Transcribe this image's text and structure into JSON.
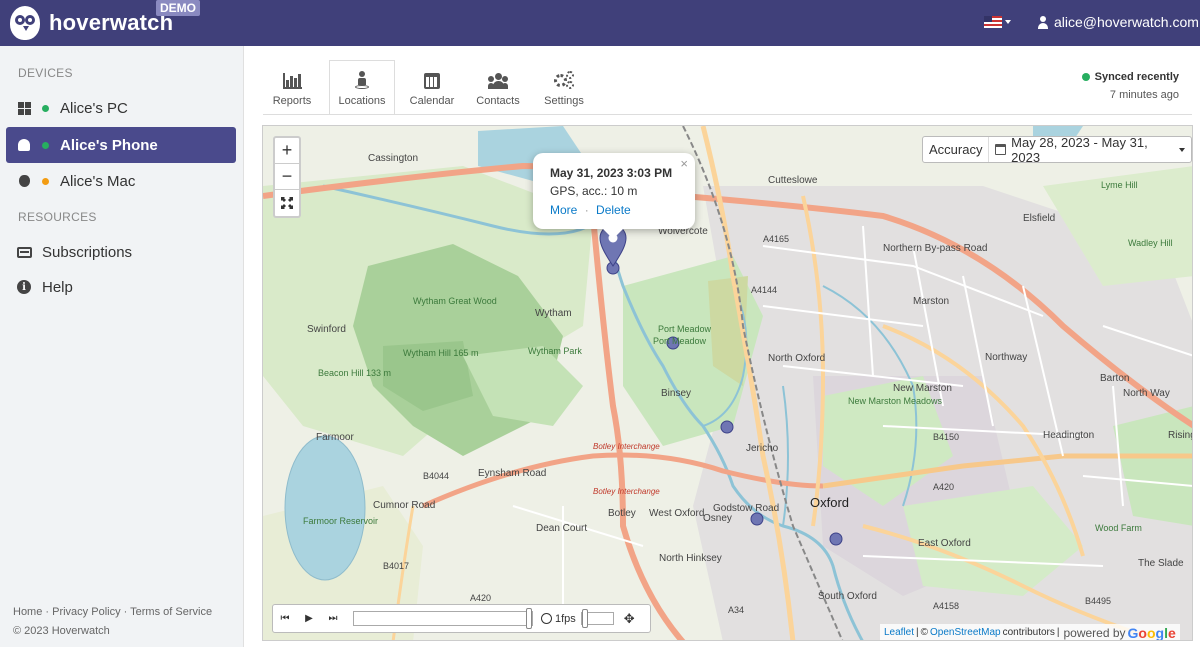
{
  "header": {
    "brand": "hoverwatch",
    "badge": "DEMO",
    "user_email": "alice@hoverwatch.com",
    "language_icon": "us-flag-icon"
  },
  "sidebar": {
    "devices_heading": "DEVICES",
    "devices": [
      {
        "label": "Alice's PC",
        "icon": "windows-icon",
        "status_color": "#27ae60"
      },
      {
        "label": "Alice's Phone",
        "icon": "android-icon",
        "status_color": "#27ae60",
        "active": true
      },
      {
        "label": "Alice's Mac",
        "icon": "apple-icon",
        "status_color": "#f39c12"
      }
    ],
    "resources_heading": "RESOURCES",
    "resources": [
      {
        "label": "Subscriptions",
        "icon": "credit-card-icon"
      },
      {
        "label": "Help",
        "icon": "info-icon"
      }
    ],
    "footer_links": "Home · Privacy Policy · Terms of Service",
    "copyright": "© 2023 Hoverwatch"
  },
  "tabs": [
    {
      "label": "Reports",
      "icon": "bar-chart-icon"
    },
    {
      "label": "Locations",
      "icon": "location-person-icon",
      "active": true
    },
    {
      "label": "Calendar",
      "icon": "calendar-icon"
    },
    {
      "label": "Contacts",
      "icon": "users-icon"
    },
    {
      "label": "Settings",
      "icon": "cogs-icon"
    }
  ],
  "sync": {
    "status": "Synced recently",
    "time": "7 minutes ago",
    "color": "#27ae60"
  },
  "map": {
    "zoom_in": "+",
    "zoom_out": "−",
    "accuracy_label": "Accuracy",
    "date_range": "May 28, 2023 - May 31, 2023",
    "popup": {
      "title": "May 31, 2023 3:03 PM",
      "detail": "GPS, acc.: 10 m",
      "more": "More",
      "separator": "·",
      "delete": "Delete",
      "close": "×"
    },
    "place_labels": [
      "Cassington",
      "Cutteslowe",
      "Wolvercote",
      "Lyme Hill",
      "Elsfield",
      "Wadley Hill",
      "A4165",
      "Northern By-pass Road",
      "A4144",
      "Marston",
      "Swinford",
      "Wytham Great Wood",
      "Wytham",
      "Port Meadow",
      "Port Meadow",
      "Wytham Hill 165 m",
      "Wytham Park",
      "North Oxford",
      "Northway",
      "Barton",
      "Beacon Hill 133 m",
      "New Marston",
      "New Marston Meadows",
      "Binsey",
      "Farmoor",
      "Jericho",
      "Headington",
      "Risinghu",
      "B4150",
      "Botley Interchange",
      "B4044",
      "Eynsham Road",
      "Botley Interchange",
      "Oxford",
      "A420",
      "Farmoor Reservoir",
      "Cumnor Road",
      "Botley",
      "West Oxford",
      "Osney",
      "Dean Court",
      "Wood Farm",
      "East Oxford",
      "North Hinksey",
      "B4017",
      "A420",
      "A34",
      "South Oxford",
      "A4158",
      "B4495",
      "Godstow Road",
      "The Slade",
      "North Way"
    ],
    "player": {
      "rewind": "⏮",
      "play": "▶",
      "forward": "⏭",
      "fps": "1fps",
      "move": "✥"
    },
    "attribution": {
      "leaflet": "Leaflet",
      "sep": "|",
      "copyright": "©",
      "osm": "OpenStreetMap",
      "contributors": "contributors",
      "powered": "powered by",
      "google": [
        "G",
        "o",
        "o",
        "g",
        "l",
        "e"
      ]
    }
  }
}
